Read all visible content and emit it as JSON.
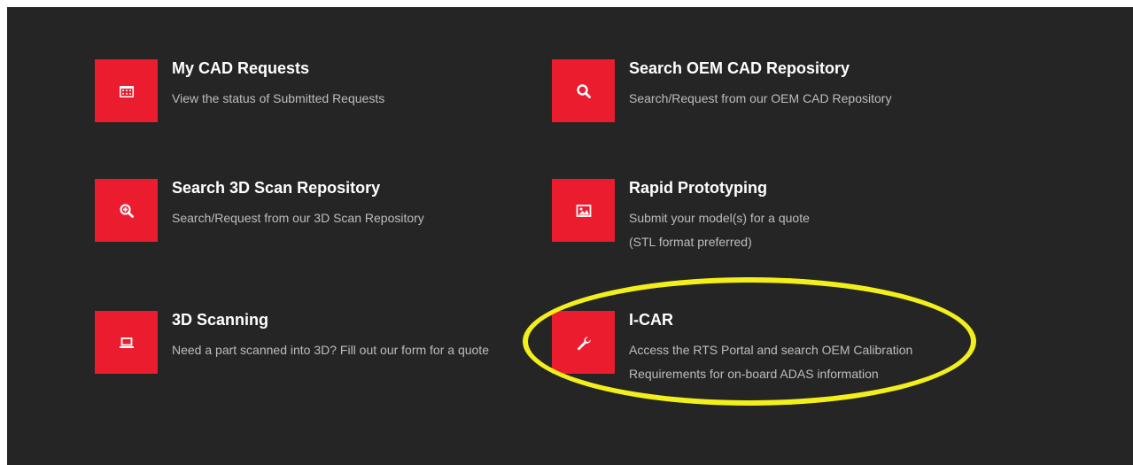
{
  "colors": {
    "background": "#252525",
    "tile": "#ea1c2d",
    "title_text": "#ffffff",
    "description_text": "#bdbdbd",
    "highlight": "#f3ef1b"
  },
  "cards": [
    {
      "icon": "calendar-icon",
      "title": "My CAD Requests",
      "lines": [
        "View the status of Submitted Requests"
      ]
    },
    {
      "icon": "search-icon",
      "title": "Search OEM CAD Repository",
      "lines": [
        "Search/Request from our OEM CAD Repository"
      ]
    },
    {
      "icon": "zoom-in-icon",
      "title": "Search 3D Scan Repository",
      "lines": [
        "Search/Request from our 3D Scan Repository"
      ]
    },
    {
      "icon": "image-icon",
      "title": "Rapid Prototyping",
      "lines": [
        "Submit your model(s) for a quote",
        "(STL format preferred)"
      ]
    },
    {
      "icon": "laptop-icon",
      "title": "3D Scanning",
      "lines": [
        "Need a part scanned into 3D? Fill out our form for a quote"
      ]
    },
    {
      "icon": "wrench-icon",
      "title": "I-CAR",
      "lines": [
        "Access the RTS Portal and search OEM Calibration",
        "Requirements for on-board ADAS information"
      ]
    }
  ]
}
